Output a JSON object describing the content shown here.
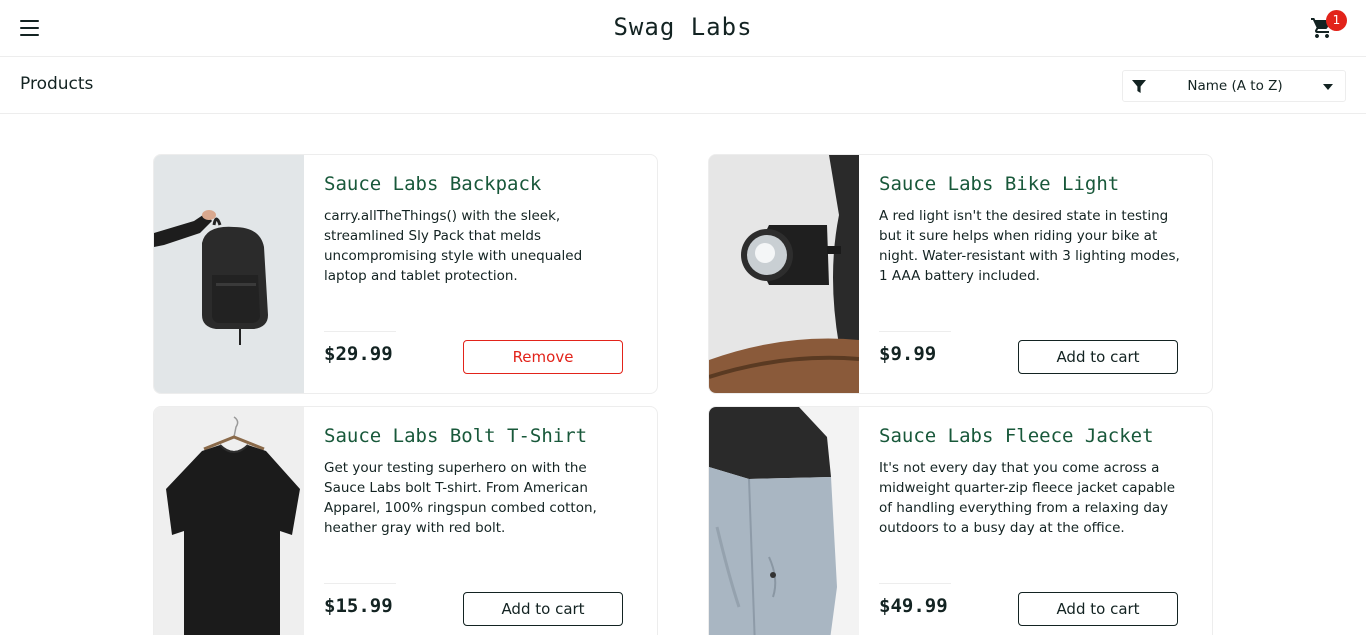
{
  "header": {
    "title": "Swag Labs",
    "menu_icon": "hamburger-menu-icon",
    "cart_icon": "shopping-cart-icon",
    "cart_count": "1",
    "badge_color": "#e2231a"
  },
  "subheader": {
    "title": "Products",
    "sort_icon": "filter-icon",
    "sort_selected": "Name (A to Z)"
  },
  "colors": {
    "item_name": "#18583a",
    "text": "#132322",
    "remove": "#e2231a"
  },
  "products": [
    {
      "name": "Sauce Labs Backpack",
      "description": "carry.allTheThings() with the sleek, streamlined Sly Pack that melds uncompromising style with unequaled laptop and tablet protection.",
      "price": "$29.99",
      "button": "Remove"
    },
    {
      "name": "Sauce Labs Bike Light",
      "description": "A red light isn't the desired state in testing but it sure helps when riding your bike at night. Water-resistant with 3 lighting modes, 1 AAA battery included.",
      "price": "$9.99",
      "button": "Add to cart"
    },
    {
      "name": "Sauce Labs Bolt T-Shirt",
      "description": "Get your testing superhero on with the Sauce Labs bolt T-shirt. From American Apparel, 100% ringspun combed cotton, heather gray with red bolt.",
      "price": "$15.99",
      "button": "Add to cart"
    },
    {
      "name": "Sauce Labs Fleece Jacket",
      "description": "It's not every day that you come across a midweight quarter-zip fleece jacket capable of handling everything from a relaxing day outdoors to a busy day at the office.",
      "price": "$49.99",
      "button": "Add to cart"
    }
  ]
}
